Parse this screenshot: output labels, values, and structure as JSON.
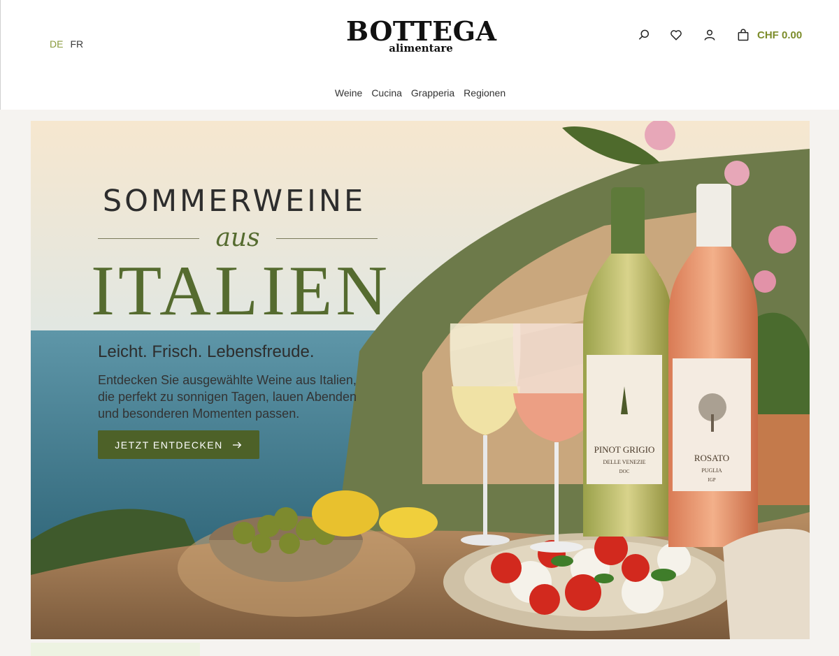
{
  "languages": [
    {
      "code": "DE",
      "active": true
    },
    {
      "code": "FR",
      "active": false
    }
  ],
  "logo": {
    "main": "BOTTEGA",
    "sub": "alimentare"
  },
  "header_icons": [
    "search-icon",
    "heart-icon",
    "user-icon",
    "bag-icon"
  ],
  "cart": {
    "total": "CHF 0.00"
  },
  "nav": {
    "items": [
      "Weine",
      "Cucina",
      "Grapperia",
      "Regionen"
    ]
  },
  "hero": {
    "title_top": "SOMMERWEINE",
    "title_mid": "aus",
    "title_big": "ITALIEN",
    "tagline": "Leicht. Frisch. Lebensfreude.",
    "description": "Entdecken Sie ausgewählte Weine aus Italien, die perfekt zu sonnigen Tagen, lauen Abenden und besonderen Momenten passen.",
    "cta_label": "JETZT ENTDECKEN",
    "bottles": [
      {
        "name": "PINOT GRIGIO",
        "region": "DELLE VENEZIE",
        "classification": "DOC"
      },
      {
        "name": "ROSATO",
        "region": "PUGLIA",
        "classification": "IGP"
      }
    ]
  },
  "colors": {
    "accent": "#7c8c2a",
    "cta": "#4d6128",
    "title_green": "#556b2f",
    "header_bg": "#ffffff",
    "page_bg": "#f5f3f0"
  }
}
